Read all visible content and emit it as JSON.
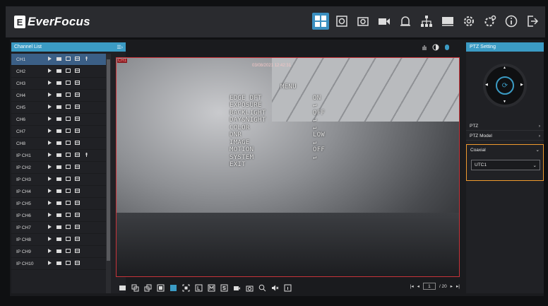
{
  "brand": {
    "name": "EverFocus",
    "mark": "E"
  },
  "topbar": {
    "icons": [
      "live-view-icon",
      "playback-icon",
      "snapshot-icon",
      "record-icon",
      "alarm-icon",
      "network-icon",
      "storage-icon",
      "settings-icon",
      "advanced-settings-icon",
      "info-icon",
      "logout-icon"
    ],
    "accent": "#3a8fc0"
  },
  "channel_list": {
    "title": "Channel List",
    "toggle": "☰›",
    "channels": [
      {
        "name": "CH1",
        "selected": true
      },
      {
        "name": "CH2"
      },
      {
        "name": "CH3"
      },
      {
        "name": "CH4"
      },
      {
        "name": "CH5"
      },
      {
        "name": "CH6"
      },
      {
        "name": "CH7"
      },
      {
        "name": "CH8"
      },
      {
        "name": "IP CH1"
      },
      {
        "name": "IP CH2"
      },
      {
        "name": "IP CH3"
      },
      {
        "name": "IP CH4"
      },
      {
        "name": "IP CH5"
      },
      {
        "name": "IP CH6"
      },
      {
        "name": "IP CH7"
      },
      {
        "name": "IP CH8"
      },
      {
        "name": "IP CH9"
      },
      {
        "name": "IP CH10"
      }
    ]
  },
  "video": {
    "channel_label": "CH1",
    "timestamp": "03/08/2021 12:42:31",
    "osd_menu": {
      "title": "MENU",
      "items": [
        {
          "name": "EDGE DFT",
          "value": "ON"
        },
        {
          "name": "EXPOSURE",
          "value": "↵"
        },
        {
          "name": "BACKLIGHT",
          "value": "OFF"
        },
        {
          "name": "DAY&NIGHT",
          "value": "↵"
        },
        {
          "name": "COLOR",
          "value": "↵"
        },
        {
          "name": "DNR",
          "value": "LOW"
        },
        {
          "name": "IMAGE",
          "value": "↵"
        },
        {
          "name": "MOTION",
          "value": "OFF"
        },
        {
          "name": "SYSTEM",
          "value": "↵"
        },
        {
          "name": "EXIT",
          "value": ""
        }
      ]
    },
    "border_color": "#c8343a"
  },
  "pager": {
    "current": "1",
    "total": "/ 20"
  },
  "ptz": {
    "title": "PTZ Setting",
    "ptz_label": "PTZ",
    "model_label": "PTZ Model",
    "coaxial_label": "Coaxial",
    "selected_protocol": "UTC1",
    "highlight_color": "#f09a2e"
  }
}
